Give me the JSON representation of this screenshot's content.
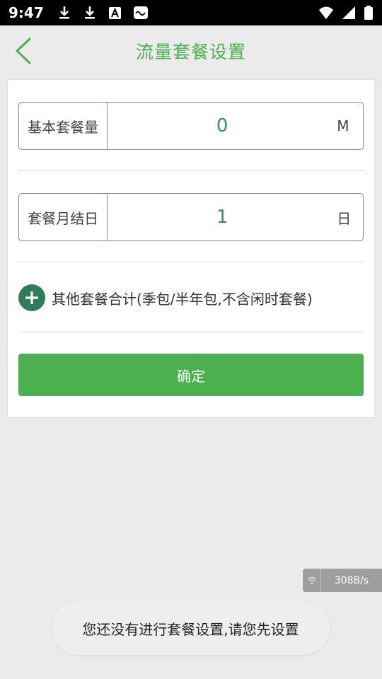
{
  "status_bar": {
    "time": "9:47",
    "left_icons": [
      "download-icon",
      "download-icon",
      "a-box-icon",
      "notification-icon"
    ],
    "right_icons": [
      "wifi-icon",
      "signal-icon",
      "battery-icon"
    ]
  },
  "header": {
    "back_icon": "chevron-left-icon",
    "title": "流量套餐设置"
  },
  "form": {
    "base_plan": {
      "label": "基本套餐量",
      "value": "0",
      "unit": "M"
    },
    "billing_day": {
      "label": "套餐月结日",
      "value": "1",
      "unit": "日"
    },
    "other_plans": {
      "icon": "plus-circle-icon",
      "label": "其他套餐合计(季包/半年包,不含闲时套餐)"
    },
    "confirm_label": "确定"
  },
  "net_speed": {
    "icon": "wifi-icon",
    "value": "308B/s"
  },
  "toast": {
    "message": "您还没有进行套餐设置,请您先设置"
  },
  "colors": {
    "accent": "#4caf50",
    "dark_green": "#2e7d57",
    "background": "#ebebeb"
  }
}
